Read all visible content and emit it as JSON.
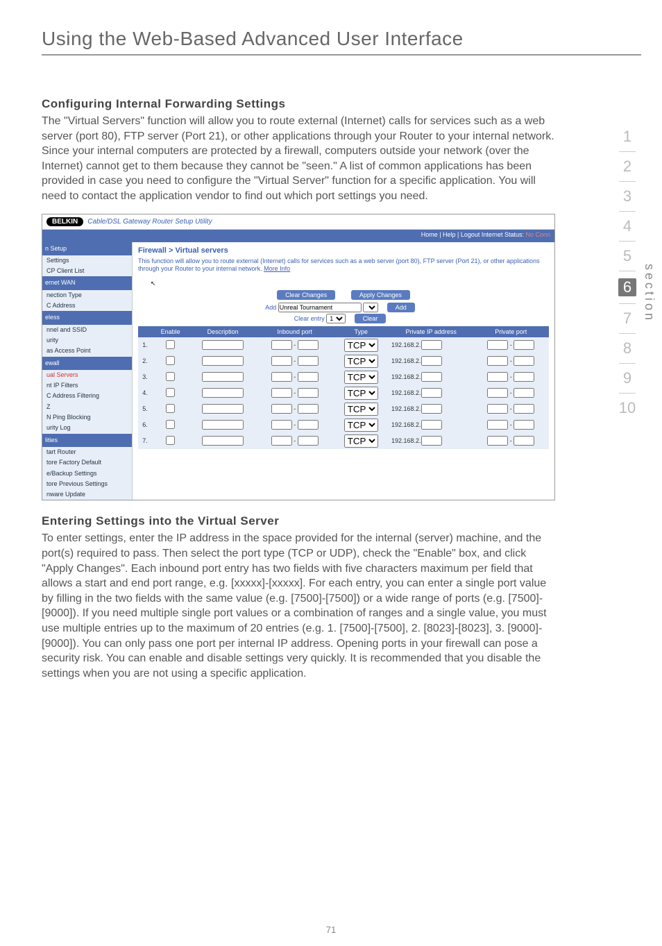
{
  "page": {
    "title": "Using the Web-Based Advanced User Interface",
    "footer_number": "71"
  },
  "sections": {
    "config_heading": "Configuring Internal Forwarding Settings",
    "config_body": "The \"Virtual Servers\" function will allow you to route external (Internet) calls for services such as a web server (port 80), FTP server (Port 21), or other applications through your Router to your internal network. Since your internal computers are protected by a firewall, computers outside your network (over the Internet) cannot get to them because they cannot be \"seen.\" A list of common applications has been provided in case you need to configure the \"Virtual Server\" function for a specific application. You will need to contact the application vendor to find out which port settings you need.",
    "enter_heading": "Entering Settings into the Virtual Server",
    "enter_body": "To enter settings, enter the IP address in the space provided for the internal (server) machine, and the port(s) required to pass. Then select the port type (TCP or UDP), check the \"Enable\" box, and click \"Apply Changes\". Each inbound port entry has two fields with five characters maximum per field that allows a start and end port range, e.g. [xxxxx]-[xxxxx]. For each entry, you can enter a single port value by filling in the two fields with the same value (e.g. [7500]-[7500]) or a wide range of ports (e.g. [7500]-[9000]). If you need multiple single port values or a combination of ranges and a single value, you must use multiple entries up to the maximum of 20 entries (e.g. 1. [7500]-[7500], 2. [8023]-[8023], 3. [9000]-[9000]). You can only pass one port per internal IP address. Opening ports in your firewall can pose a security risk. You can enable and disable settings very quickly. It is recommended that you disable the settings when you are not using a specific application."
  },
  "sidenav": {
    "section_word": "section",
    "items": [
      "1",
      "2",
      "3",
      "4",
      "5",
      "6",
      "7",
      "8",
      "9",
      "10"
    ],
    "active_index": 5
  },
  "screenshot": {
    "brand": "BELKIN",
    "subtitle": "Cable/DSL Gateway Router Setup Utility",
    "topbar_left": "",
    "topbar_right_prefix": "Home | Help | Logout   Internet Status: ",
    "topbar_right_status": "No Conn",
    "side": {
      "groups": [
        {
          "head": "n Setup",
          "items": [
            "Settings",
            "CP Client List"
          ]
        },
        {
          "head": "ernet WAN",
          "items": [
            "nection Type",
            "",
            "C Address"
          ]
        },
        {
          "head": "eless",
          "items": [
            "nnel and SSID",
            "urity",
            "as Access Point"
          ]
        },
        {
          "head": "ewall",
          "items": [
            {
              "label": "ual Servers",
              "sel": true
            },
            "nt IP Filters",
            "C Address Filtering",
            "Z",
            "N Ping Blocking",
            "urity Log"
          ]
        },
        {
          "head": "lities",
          "items": [
            "tart Router",
            "tore Factory Default",
            "e/Backup Settings",
            "tore Previous Settings",
            "nware Update"
          ]
        }
      ]
    },
    "main": {
      "crumb": "Firewall > Virtual servers",
      "desc": "This function will allow you to route external (Internet) calls for services such as a web server (port 80), FTP server (Port 21), or other applications through your Router to your internal network.",
      "more_info": "More Info",
      "clear_changes": "Clear Changes",
      "apply_changes": "Apply Changes",
      "add_label": "Add",
      "add_value": "Unreal Tournament",
      "add_button": "Add",
      "clear_entry_label": "Clear entry",
      "clear_entry_value": "1",
      "clear_button": "Clear",
      "cols": [
        "",
        "Enable",
        "Description",
        "Inbound port",
        "Type",
        "Private IP address",
        "Private port"
      ],
      "rows": [
        {
          "n": "1.",
          "ip": "192.168.2.",
          "type": "TCP"
        },
        {
          "n": "2.",
          "ip": "192.168.2.",
          "type": "TCP"
        },
        {
          "n": "3.",
          "ip": "192.168.2.",
          "type": "TCP"
        },
        {
          "n": "4.",
          "ip": "192.168.2.",
          "type": "TCP"
        },
        {
          "n": "5.",
          "ip": "192.168.2.",
          "type": "TCP"
        },
        {
          "n": "6.",
          "ip": "192.168.2.",
          "type": "TCP"
        },
        {
          "n": "7.",
          "ip": "192.168.2.",
          "type": "TCP"
        }
      ]
    }
  }
}
